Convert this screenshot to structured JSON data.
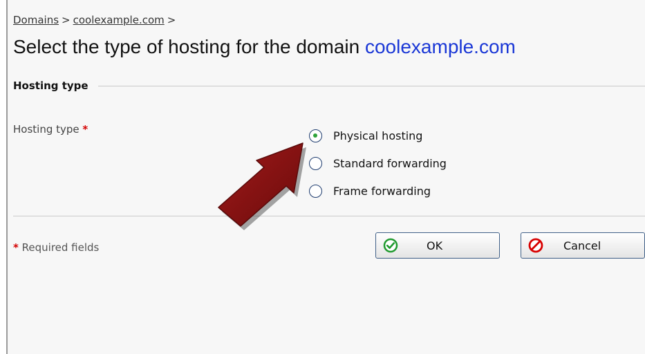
{
  "breadcrumb": {
    "items": [
      "Domains",
      "coolexample.com"
    ],
    "separator": ">"
  },
  "page": {
    "title_prefix": "Select the type of hosting for the domain",
    "title_domain": "coolexample.com"
  },
  "section": {
    "title": "Hosting type"
  },
  "form": {
    "field_label": "Hosting type",
    "required_mark": "*",
    "options": [
      {
        "label": "Physical hosting",
        "checked": true
      },
      {
        "label": "Standard forwarding",
        "checked": false
      },
      {
        "label": "Frame forwarding",
        "checked": false
      }
    ]
  },
  "footer": {
    "required_mark": "*",
    "required_note": "Required fields",
    "ok_label": "OK",
    "cancel_label": "Cancel"
  },
  "annotation": {
    "icon": "pointer-arrow-icon",
    "color": "#7a0e0e"
  },
  "colors": {
    "link_blue": "#1a37d6",
    "required_red": "#d40000",
    "ok_green": "#1f9a2e",
    "cancel_red": "#d80000"
  }
}
